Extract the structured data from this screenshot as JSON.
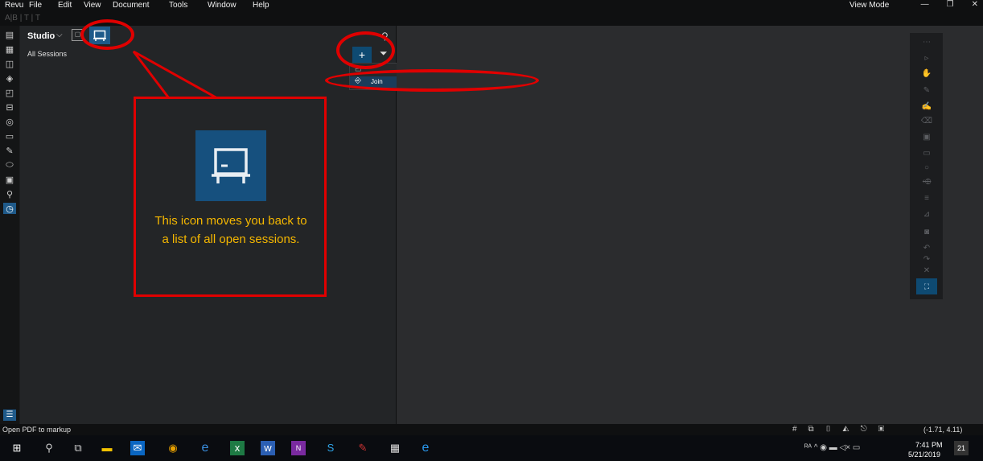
{
  "menubar": {
    "items": [
      "Revu",
      "File",
      "Edit",
      "View",
      "Document",
      "Tools",
      "Window",
      "Help"
    ],
    "view_mode": "View Mode",
    "window_controls": [
      "—",
      "❐",
      "✕"
    ]
  },
  "format_toolbar": "A|B | T | T",
  "studio": {
    "title": "Studio",
    "chevron": "⌵",
    "all_sessions": "All Sessions",
    "add_label": "+",
    "filter_icon": "filter-icon",
    "dropdown": {
      "join_label": "Join"
    }
  },
  "callout": {
    "text": "This icon moves you back to a list of all open sessions."
  },
  "status": {
    "text": "Open PDF to markup",
    "coords": "(-1.71, 4.11)"
  },
  "taskbar": {
    "time": "7:41 PM",
    "date": "5/21/2019",
    "notification_count": "21",
    "tray_text": "ᴿᴬ ^ ◉ ▬ ◁× ▭"
  },
  "colors": {
    "accent": "#1f5a8a",
    "annotation": "#e00000",
    "callout_text": "#f5b700",
    "panel": "#232527",
    "document_area": "#2b2c2e"
  }
}
